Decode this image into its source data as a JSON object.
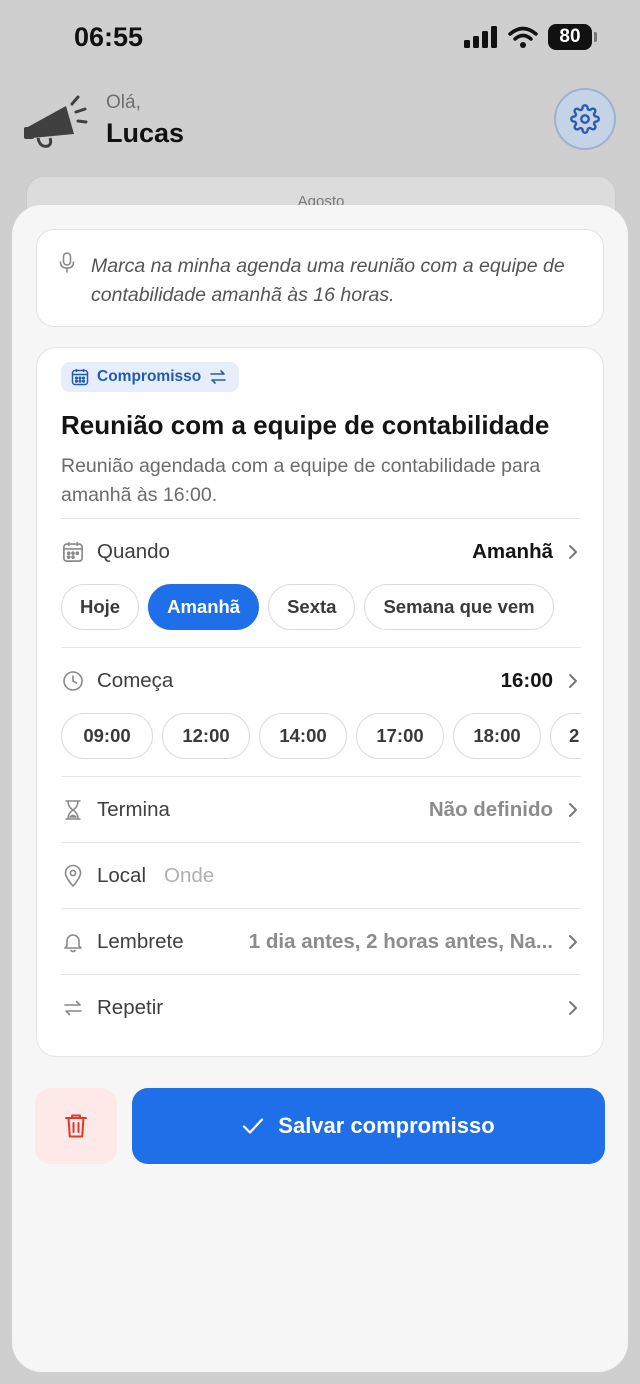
{
  "status": {
    "time": "06:55",
    "battery": "80"
  },
  "header": {
    "hello": "Olá,",
    "name": "Lucas"
  },
  "background_card": {
    "month": "Agosto"
  },
  "transcript": {
    "text": "Marca na minha agenda uma reunião com a equipe de contabilidade amanhã às 16 horas."
  },
  "event": {
    "type_label": "Compromisso",
    "title": "Reunião com a equipe de contabilidade",
    "description": "Reunião agendada com a equipe de contabilidade para amanhã às 16:00.",
    "when": {
      "label": "Quando",
      "value": "Amanhã",
      "options": [
        "Hoje",
        "Amanhã",
        "Sexta",
        "Semana que vem"
      ],
      "selected": "Amanhã"
    },
    "start": {
      "label": "Começa",
      "value": "16:00",
      "options": [
        "09:00",
        "12:00",
        "14:00",
        "17:00",
        "18:00",
        "2"
      ]
    },
    "end": {
      "label": "Termina",
      "value": "Não definido"
    },
    "location": {
      "label": "Local",
      "placeholder": "Onde"
    },
    "reminder": {
      "label": "Lembrete",
      "value": "1 dia antes, 2 horas antes, Na..."
    },
    "repeat": {
      "label": "Repetir"
    }
  },
  "actions": {
    "save_label": "Salvar compromisso"
  },
  "colors": {
    "accent": "#1f6fe8",
    "danger": "#e0392b",
    "danger_bg": "#fde9e7"
  }
}
